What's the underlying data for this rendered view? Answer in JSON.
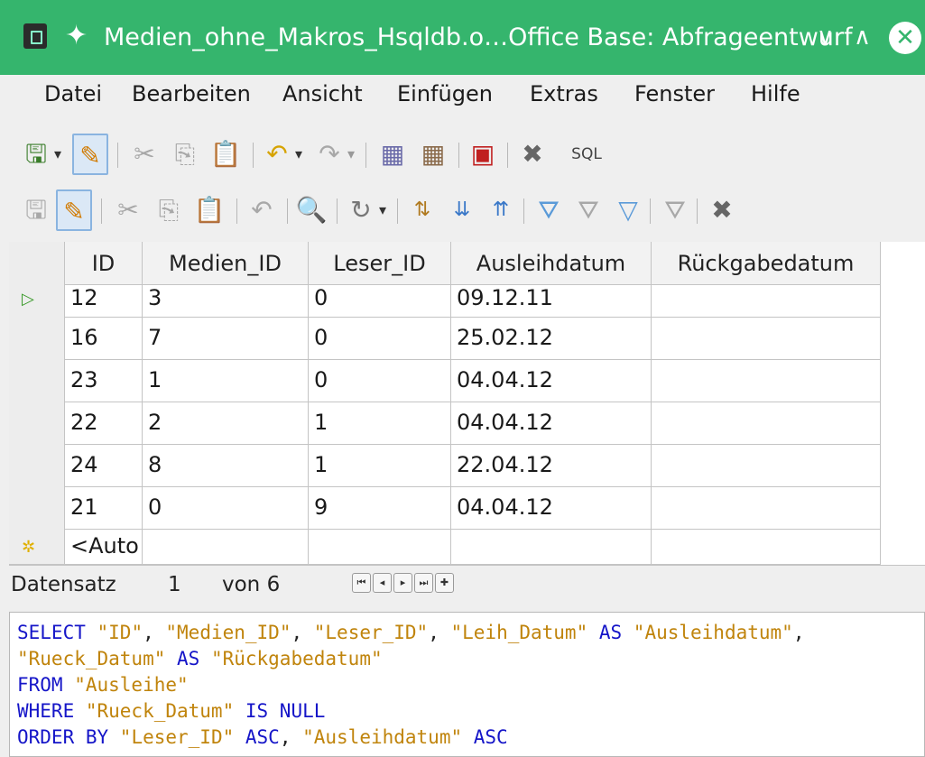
{
  "window": {
    "title": "Medien_ohne_Makros_Hsqldb.o…Office Base: Abfrageentwurf",
    "controls": [
      "minimize",
      "maximize",
      "close"
    ]
  },
  "menu": [
    {
      "label": "Datei"
    },
    {
      "label": "Bearbeiten"
    },
    {
      "label": "Ansicht"
    },
    {
      "label": "Einfügen"
    },
    {
      "label": "Extras"
    },
    {
      "label": "Fenster"
    },
    {
      "label": "Hilfe"
    }
  ],
  "toolbar1": {
    "sql_label": "SQL"
  },
  "grid": {
    "columns": [
      "ID",
      "Medien_ID",
      "Leser_ID",
      "Ausleihdatum",
      "Rückgabedatum"
    ],
    "rows": [
      [
        "12",
        "3",
        "0",
        "09.12.11",
        ""
      ],
      [
        "16",
        "7",
        "0",
        "25.02.12",
        ""
      ],
      [
        "23",
        "1",
        "0",
        "04.04.12",
        ""
      ],
      [
        "22",
        "2",
        "1",
        "04.04.12",
        ""
      ],
      [
        "24",
        "8",
        "1",
        "22.04.12",
        ""
      ],
      [
        "21",
        "0",
        "9",
        "04.04.12",
        ""
      ]
    ],
    "new_row_placeholder": "<Auto"
  },
  "navigation": {
    "record_label": "Datensatz",
    "current": "1",
    "of_label": "von 6"
  },
  "sql": {
    "lines": [
      [
        [
          "kw",
          "SELECT "
        ],
        [
          "str",
          "\"ID\""
        ],
        [
          "pl",
          ", "
        ],
        [
          "str",
          "\"Medien_ID\""
        ],
        [
          "pl",
          ", "
        ],
        [
          "str",
          "\"Leser_ID\""
        ],
        [
          "pl",
          ", "
        ],
        [
          "str",
          "\"Leih_Datum\""
        ],
        [
          "kw",
          " AS "
        ],
        [
          "str",
          "\"Ausleihdatum\""
        ],
        [
          "pl",
          ","
        ]
      ],
      [
        [
          "str",
          "\"Rueck_Datum\""
        ],
        [
          "kw",
          " AS "
        ],
        [
          "str",
          "\"Rückgabedatum\""
        ]
      ],
      [
        [
          "kw",
          "FROM "
        ],
        [
          "str",
          "\"Ausleihe\""
        ]
      ],
      [
        [
          "kw",
          "WHERE "
        ],
        [
          "str",
          "\"Rueck_Datum\""
        ],
        [
          "kw",
          " IS NULL"
        ]
      ],
      [
        [
          "kw",
          "ORDER BY "
        ],
        [
          "str",
          "\"Leser_ID\""
        ],
        [
          "kw",
          " ASC"
        ],
        [
          "pl",
          ", "
        ],
        [
          "str",
          "\"Ausleihdatum\""
        ],
        [
          "kw",
          " ASC"
        ]
      ]
    ]
  },
  "colors": {
    "titlebar": "#35b56d",
    "keyword": "#1515c8",
    "string": "#c0840c"
  }
}
